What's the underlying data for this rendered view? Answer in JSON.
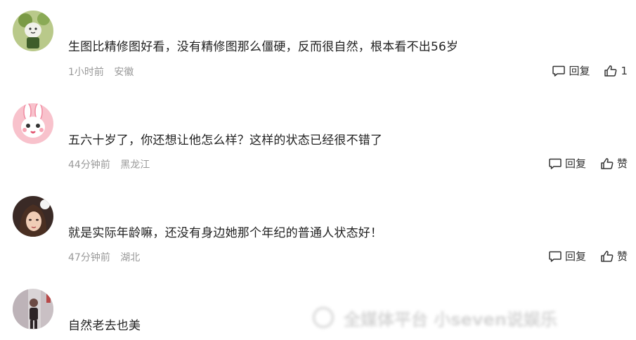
{
  "comments": [
    {
      "text": "生图比精修图好看，没有精修图那么僵硬，反而很自然，根本看不出56岁",
      "time": "1小时前",
      "location": "安徽",
      "reply_label": "回复",
      "like_label": "1",
      "avatar": "green-cartoon-avatar"
    },
    {
      "text": "五六十岁了，你还想让他怎么样？这样的状态已经很不错了",
      "time": "44分钟前",
      "location": "黑龙江",
      "reply_label": "回复",
      "like_label": "赞",
      "avatar": "pink-bunny-avatar"
    },
    {
      "text": "就是实际年龄嘛，还没有身边她那个年纪的普通人状态好！",
      "time": "47分钟前",
      "location": "湖北",
      "reply_label": "回复",
      "like_label": "赞",
      "avatar": "girl-portrait-avatar"
    },
    {
      "text": "自然老去也美",
      "avatar": "person-photo-avatar"
    }
  ],
  "watermark": {
    "text": "全媒体平台 小seven说娱乐"
  },
  "colors": {
    "text": "#222222",
    "meta": "#999999",
    "action": "#333333"
  }
}
